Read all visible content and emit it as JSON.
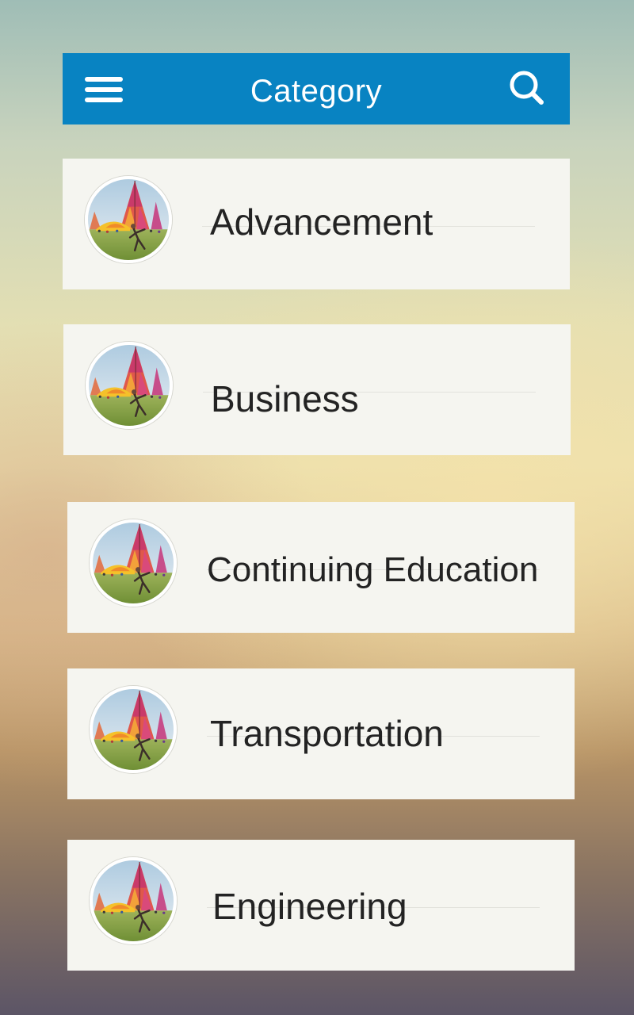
{
  "header": {
    "title": "Category",
    "menu_icon": "hamburger-menu-icon",
    "search_icon": "search-icon",
    "background_color": "#0883c2"
  },
  "categories": [
    {
      "label": "Advancement",
      "thumbnail": "festival-photo-thumbnail"
    },
    {
      "label": "Business",
      "thumbnail": "festival-photo-thumbnail"
    },
    {
      "label": "Continuing Education",
      "thumbnail": "festival-photo-thumbnail"
    },
    {
      "label": "Transportation",
      "thumbnail": "festival-photo-thumbnail"
    },
    {
      "label": "Engineering",
      "thumbnail": "festival-photo-thumbnail"
    }
  ]
}
